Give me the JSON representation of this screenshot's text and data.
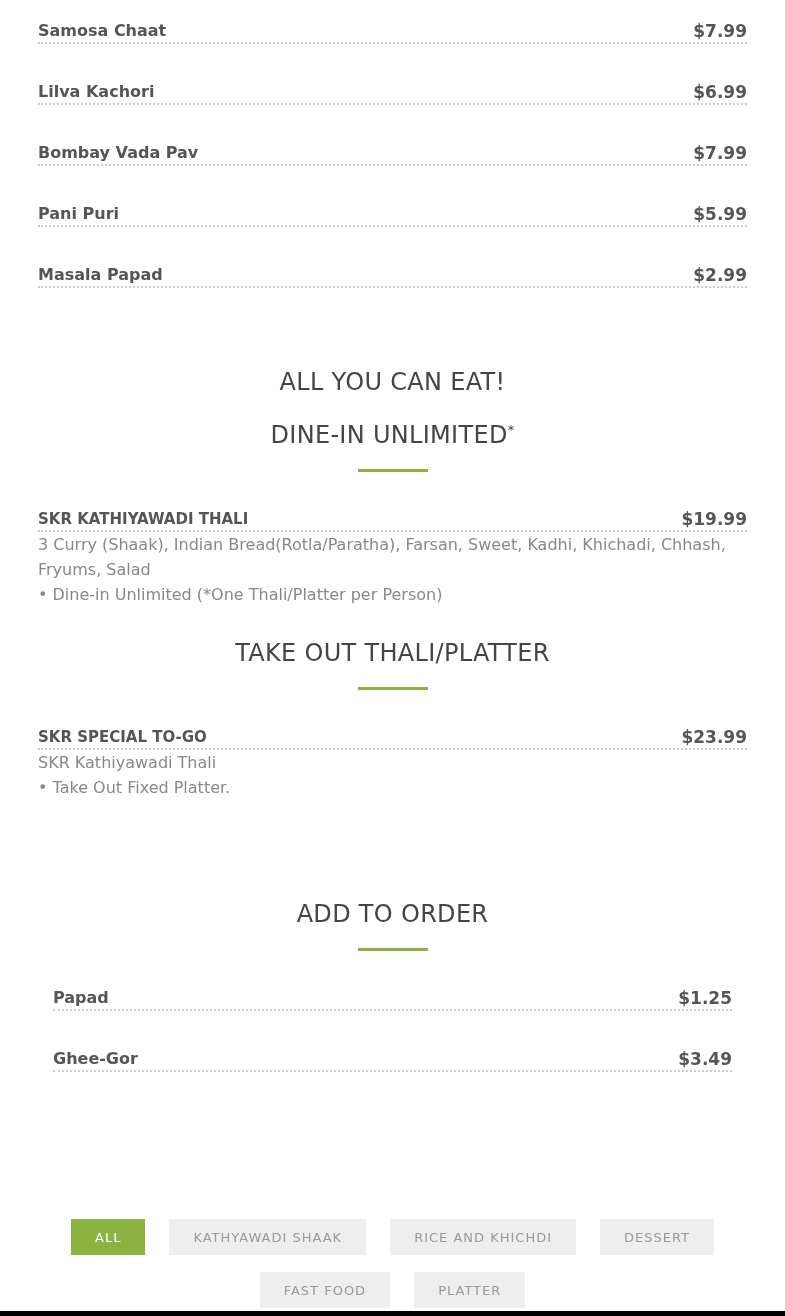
{
  "menu_items": [
    {
      "name": "Samosa Chaat",
      "price": "$7.99"
    },
    {
      "name": "Lilva Kachori",
      "price": "$6.99"
    },
    {
      "name": "Bombay Vada Pav",
      "price": "$7.99"
    },
    {
      "name": "Pani Puri",
      "price": "$5.99"
    },
    {
      "name": "Masala Papad",
      "price": "$2.99"
    }
  ],
  "sections": [
    {
      "headings": [
        "ALL YOU CAN EAT!",
        "DINE-IN UNLIMITED$^{*}$"
      ],
      "items": [
        {
          "name": "SKR KATHIYAWADI THALI",
          "price": "$19.99",
          "description": [
            "3 Curry (Shaak), Indian Bread(Rotla/Paratha), Farsan, Sweet, Kadhi, Khichadi, Chhash, Fryums, Salad",
            "• Dine-in Unlimited (*One Thali/Platter per Person)"
          ]
        }
      ]
    },
    {
      "headings": [
        "TAKE OUT THALI/PLATTER"
      ],
      "items": [
        {
          "name": "SKR SPECIAL TO-GO",
          "price": "$23.99",
          "description": [
            "SKR Kathiyawadi Thali",
            "• Take Out Fixed Platter."
          ]
        }
      ]
    }
  ],
  "add_to_order": {
    "heading": "ADD TO ORDER",
    "items": [
      {
        "name": "Papad",
        "price": "$1.25"
      },
      {
        "name": "Ghee-Gor",
        "price": "$3.49"
      }
    ]
  },
  "filters": [
    {
      "label": "ALL",
      "selected": true
    },
    {
      "label": "KATHYAWADI SHAAK",
      "selected": false
    },
    {
      "label": "RICE AND KHICHDI",
      "selected": false
    },
    {
      "label": "DESSERT",
      "selected": false
    },
    {
      "label": "FAST FOOD",
      "selected": false
    },
    {
      "label": "PLATTER",
      "selected": false
    }
  ]
}
